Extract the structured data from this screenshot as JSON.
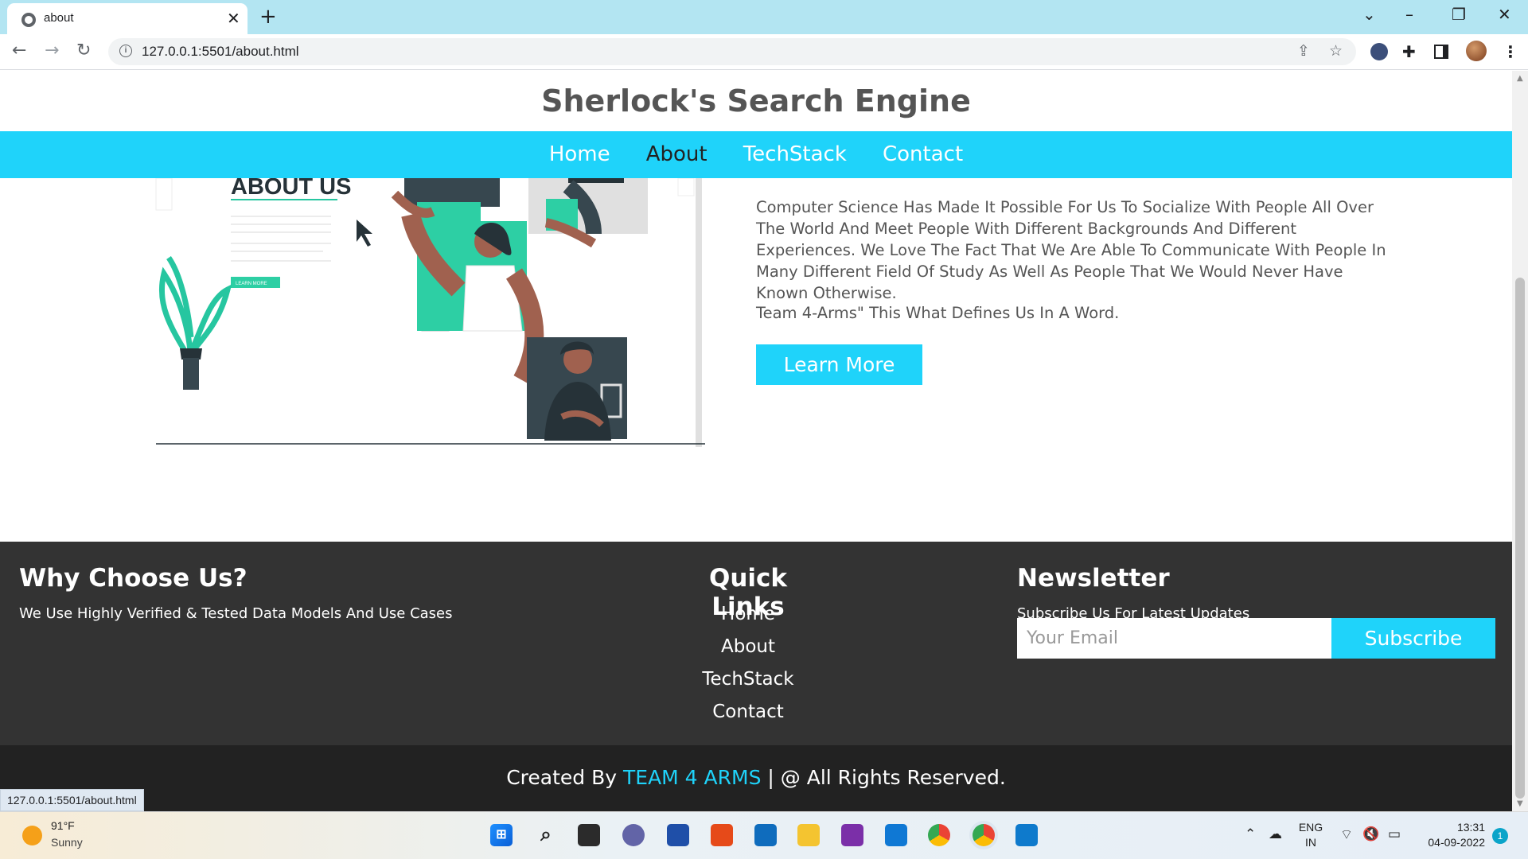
{
  "browser": {
    "tab_title": "about",
    "new_tab_glyph": "+",
    "tab_close_glyph": "✕",
    "url": "127.0.0.1:5501/about.html",
    "status_url": "127.0.0.1:5501/about.html",
    "icons": [
      "back-icon",
      "forward-icon",
      "reload-icon",
      "info-icon",
      "share-icon",
      "star-icon",
      "extension-icon",
      "puzzle-icon",
      "sidepanel-icon",
      "menu-icon"
    ]
  },
  "site": {
    "title": "Sherlock's Search Engine",
    "nav": [
      {
        "label": "Home",
        "active": false
      },
      {
        "label": "About",
        "active": true
      },
      {
        "label": "TechStack",
        "active": false
      },
      {
        "label": "Contact",
        "active": false
      }
    ],
    "accent_color": "#1fd3fa"
  },
  "about": {
    "illustration_heading": "ABOUT US",
    "illustration_button": "LEARN MORE",
    "paragraph": "Computer Science Has Made It Possible For Us To Socialize With People All Over The World And Meet People With Different Backgrounds And Different Experiences. We Love The Fact That We Are Able To Communicate With People In Many Different Field Of Study As Well As People That We Would Never Have Known Otherwise.",
    "tagline": "Team 4-Arms\" This What Defines Us In A Word.",
    "learn_more": "Learn More"
  },
  "footer": {
    "why": {
      "heading": "Why Choose Us?",
      "text": "We Use Highly Verified & Tested Data Models And Use Cases"
    },
    "quick_links": {
      "heading": "Quick Links",
      "links": [
        "Home",
        "About",
        "TechStack",
        "Contact"
      ]
    },
    "newsletter": {
      "heading": "Newsletter",
      "text": "Subscribe Us For Latest Updates",
      "placeholder": "Your Email",
      "button": "Subscribe"
    },
    "credits_prefix": "Created By",
    "credits_team": "TEAM 4 ARMS",
    "credits_suffix": "| @ All Rights Reserved."
  },
  "taskbar": {
    "weather_temp": "91°F",
    "weather_desc": "Sunny",
    "lang_line1": "ENG",
    "lang_line2": "IN",
    "time": "13:31",
    "date": "04-09-2022",
    "notifications": "1"
  }
}
